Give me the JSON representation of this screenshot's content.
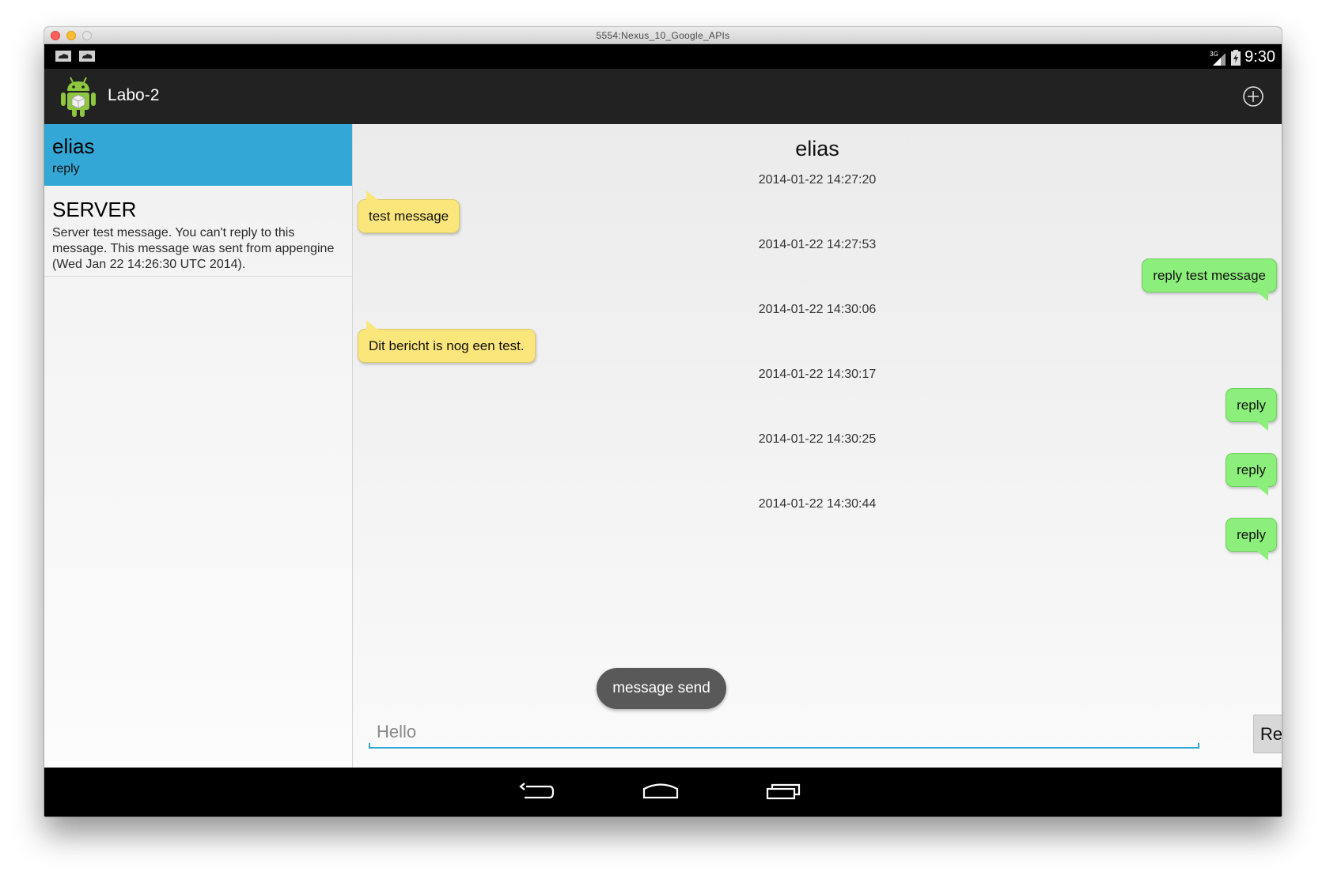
{
  "window": {
    "title": "5554:Nexus_10_Google_APIs"
  },
  "status_bar": {
    "time": "9:30",
    "network": "3G"
  },
  "action_bar": {
    "app_title": "Labo-2"
  },
  "conversations": [
    {
      "name": "elias",
      "preview": "reply",
      "selected": true
    },
    {
      "name": "SERVER",
      "preview": "Server test message. You can't reply to this message. This message was sent from appengine (Wed Jan 22 14:26:30 UTC 2014).",
      "selected": false
    }
  ],
  "chat": {
    "contact": "elias",
    "messages": [
      {
        "timestamp": "2014-01-22 14:27:20",
        "text": "test message",
        "direction": "incoming"
      },
      {
        "timestamp": "2014-01-22 14:27:53",
        "text": "reply test message",
        "direction": "outgoing"
      },
      {
        "timestamp": "2014-01-22 14:30:06",
        "text": "Dit bericht is nog een test.",
        "direction": "incoming"
      },
      {
        "timestamp": "2014-01-22 14:30:17",
        "text": "reply",
        "direction": "outgoing"
      },
      {
        "timestamp": "2014-01-22 14:30:25",
        "text": "reply",
        "direction": "outgoing"
      },
      {
        "timestamp": "2014-01-22 14:30:44",
        "text": "reply",
        "direction": "outgoing"
      }
    ],
    "toast": "message send",
    "input": {
      "value": "",
      "placeholder": "Hello"
    },
    "reply_label": "Reply"
  },
  "colors": {
    "selected": "#33a8d6",
    "incoming_bubble": "#fbe67c",
    "outgoing_bubble": "#8def7b",
    "action_bar": "#222222"
  },
  "icons": {
    "app": "android-robot-icon",
    "add": "add-circle-icon",
    "notifications": [
      "cloud-notification-icon",
      "cloud-notification-icon"
    ],
    "nav": [
      "back-icon",
      "home-icon",
      "recent-apps-icon"
    ]
  }
}
